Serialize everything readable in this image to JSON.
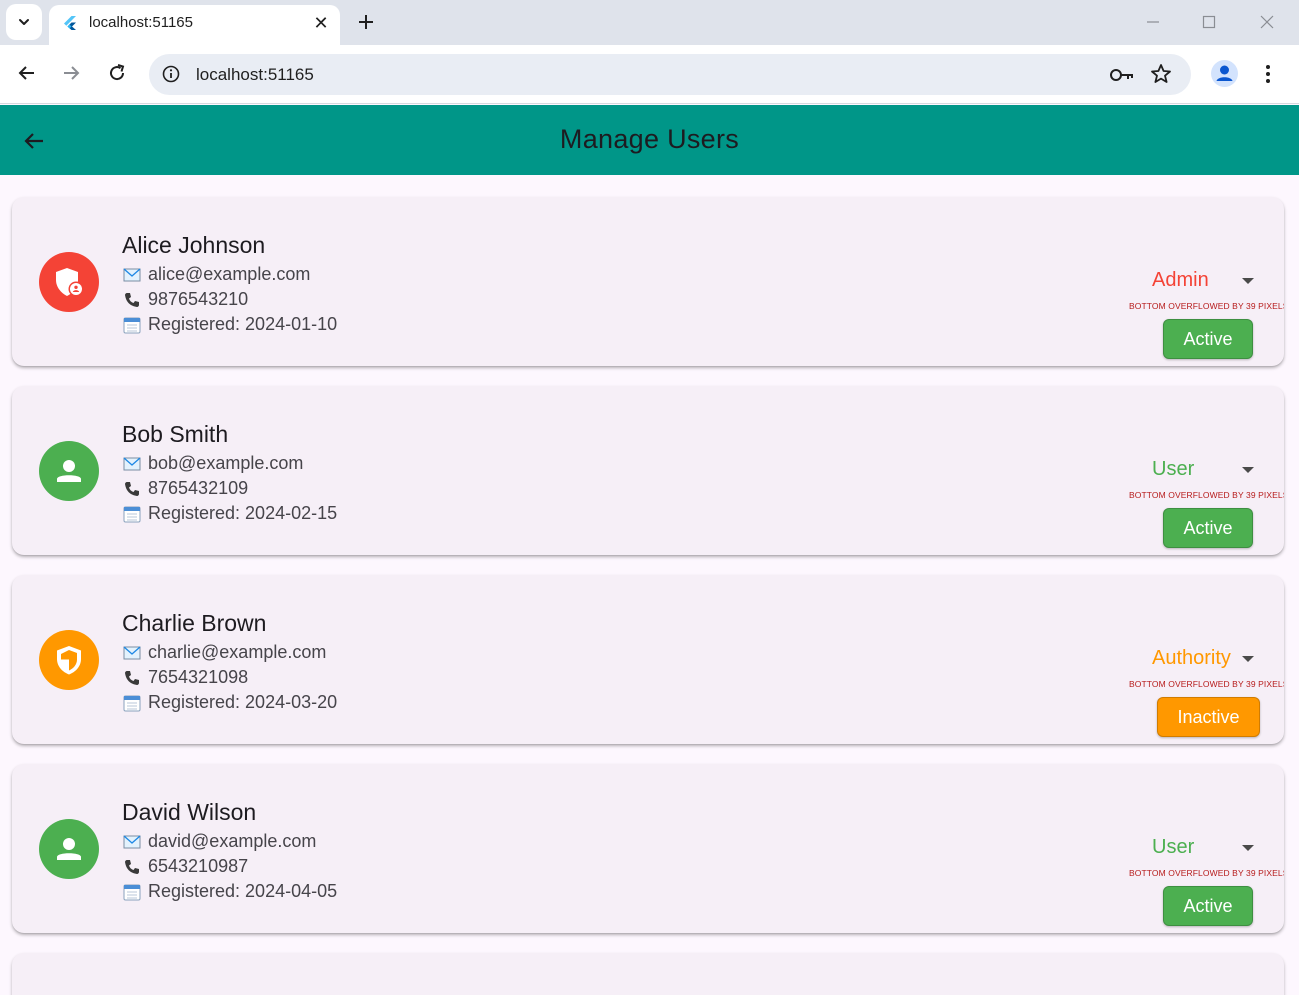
{
  "browser": {
    "tab_title": "localhost:51165",
    "url": "localhost:51165",
    "icons": {
      "tab_menu": "chevron-down-icon",
      "favicon": "flutter-icon",
      "tab_close": "close-icon",
      "new_tab": "plus-icon",
      "minimize": "minimize-icon",
      "maximize": "maximize-icon",
      "close_window": "close-icon",
      "back": "arrow-left-icon",
      "forward": "arrow-right-icon",
      "reload": "reload-icon",
      "site_info": "info-icon",
      "passwords": "key-icon",
      "bookmark": "star-icon",
      "profile": "person-icon",
      "menu": "more-vert-icon"
    }
  },
  "appbar": {
    "title": "Manage Users",
    "back_icon": "arrow-left-icon",
    "color": "#009688"
  },
  "users": [
    {
      "name": "Alice Johnson",
      "email": "alice@example.com",
      "phone": "9876543210",
      "registered": "Registered: 2024-01-10",
      "role": "Admin",
      "role_color": "#f44336",
      "avatar_icon": "admin-shield-icon",
      "overflow_text": "BOTTOM OVERFLOWED BY 39 PIXELS",
      "status": "Active",
      "status_color": "#4caf50"
    },
    {
      "name": "Bob Smith",
      "email": "bob@example.com",
      "phone": "8765432109",
      "registered": "Registered: 2024-02-15",
      "role": "User",
      "role_color": "#4caf50",
      "avatar_icon": "person-icon",
      "overflow_text": "BOTTOM OVERFLOWED BY 39 PIXELS",
      "status": "Active",
      "status_color": "#4caf50"
    },
    {
      "name": "Charlie Brown",
      "email": "charlie@example.com",
      "phone": "7654321098",
      "registered": "Registered: 2024-03-20",
      "role": "Authority",
      "role_color": "#ff9800",
      "avatar_icon": "shield-icon",
      "overflow_text": "BOTTOM OVERFLOWED BY 39 PIXELS",
      "status": "Inactive",
      "status_color": "#ff9800"
    },
    {
      "name": "David Wilson",
      "email": "david@example.com",
      "phone": "6543210987",
      "registered": "Registered: 2024-04-05",
      "role": "User",
      "role_color": "#4caf50",
      "avatar_icon": "person-icon",
      "overflow_text": "BOTTOM OVERFLOWED BY 39 PIXELS",
      "status": "Active",
      "status_color": "#4caf50"
    }
  ],
  "line_icons": {
    "email": "email-emoji-icon",
    "phone": "phone-emoji-icon",
    "calendar": "calendar-emoji-icon"
  }
}
